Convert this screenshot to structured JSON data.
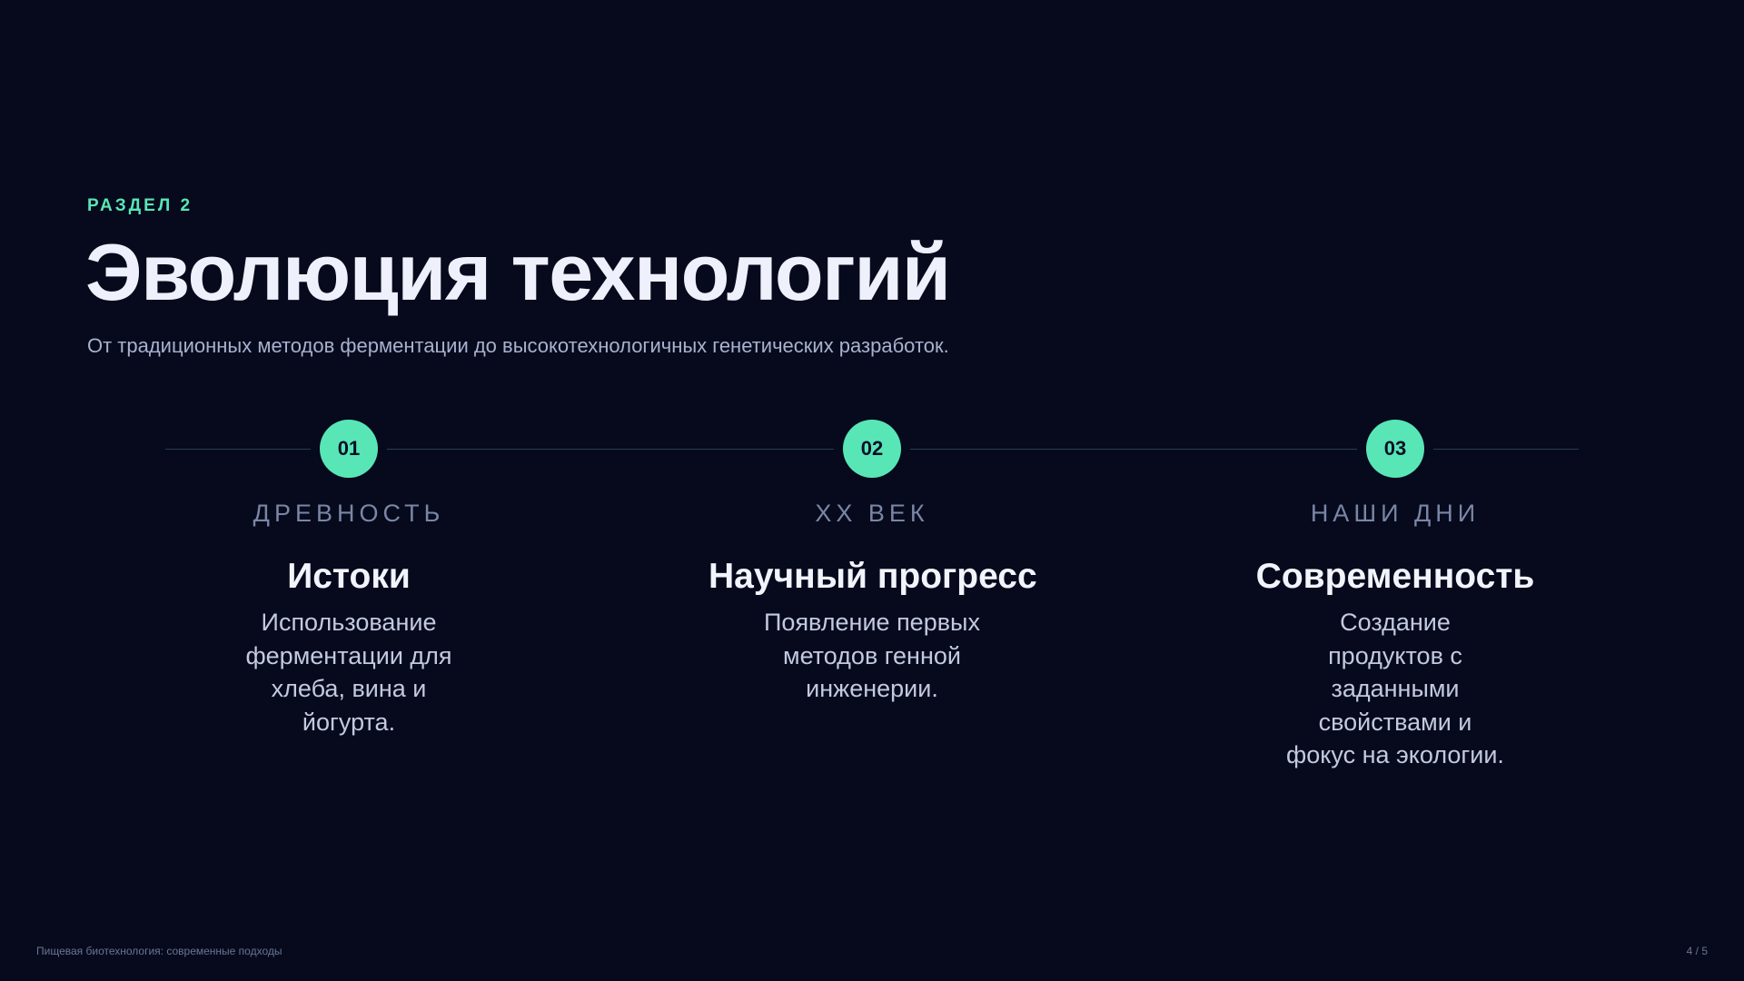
{
  "section": {
    "kicker": "РАЗДЕЛ 2",
    "title": "Эволюция технологий",
    "subtitle": "От традиционных методов ферментации до высокотехнологичных генетических разработок."
  },
  "timeline": {
    "stages": [
      {
        "number": "01",
        "era": "ДРЕВНОСТЬ",
        "heading": "Истоки",
        "text": "Использование ферментации для хлеба, вина и йогурта."
      },
      {
        "number": "02",
        "era": "XX ВЕК",
        "heading": "Научный прогресс",
        "text": "Появление первых методов генной инженерии."
      },
      {
        "number": "03",
        "era": "НАШИ ДНИ",
        "heading": "Современность",
        "text": "Создание продуктов с заданными свойствами и фокус на экологии."
      }
    ]
  },
  "footer": {
    "presentation_title": "Пищевая биотехнология: современные подходы",
    "page_indicator": "4 / 5"
  },
  "colors": {
    "background": "#060a1c",
    "accent": "#59e6b7",
    "muted": "#7a86a6"
  }
}
